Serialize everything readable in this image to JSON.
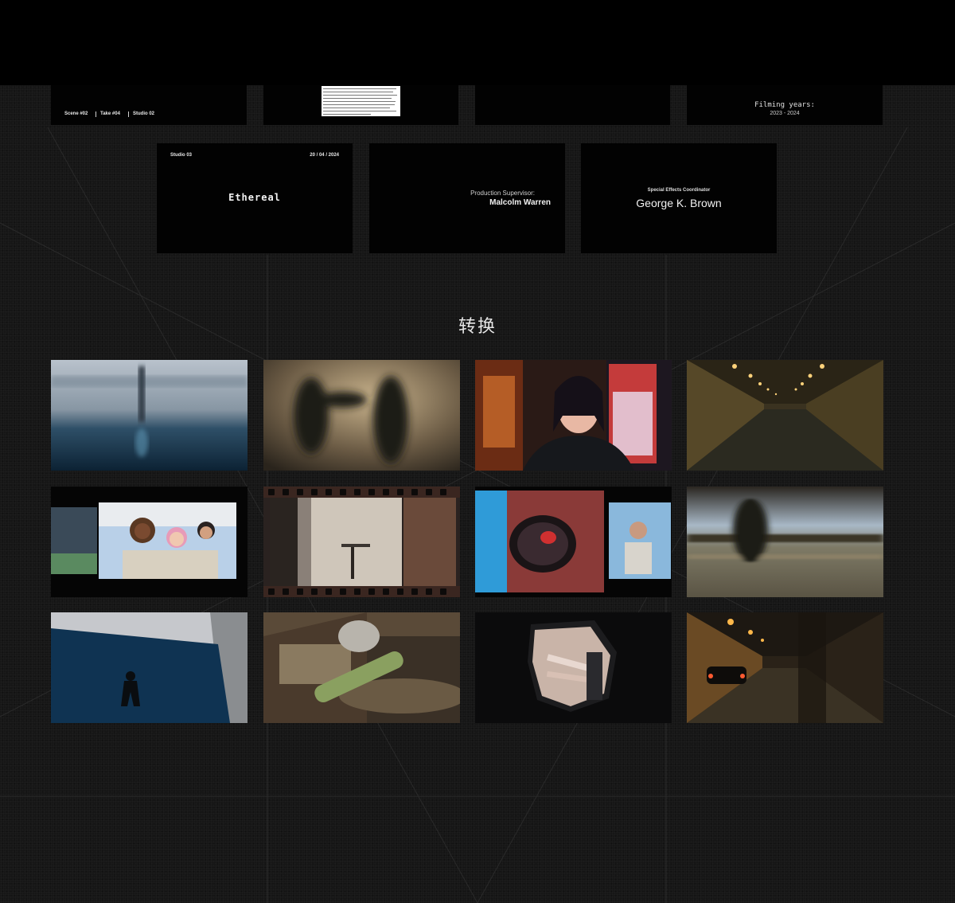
{
  "top_row": {
    "card1": {
      "scene": "Scene #02",
      "take": "Take #04",
      "studio": "Studio 02"
    },
    "card4": {
      "label": "Filming years:",
      "years": "2023 - 2024"
    }
  },
  "second_row": {
    "card1": {
      "studio": "Studio 03",
      "date": "20 / 04 / 2024",
      "title": "Ethereal"
    },
    "card2": {
      "role": "Production Supervisor:",
      "name": "Malcolm Warren"
    },
    "card3": {
      "role": "Special Effects Coordinator",
      "name": "George K. Brown"
    }
  },
  "section": {
    "title": "转换"
  },
  "thumbnails": [
    {
      "subject": "diver-silhouette-blur"
    },
    {
      "subject": "fight-motion-blur"
    },
    {
      "subject": "girl-neon-street"
    },
    {
      "subject": "tunnel-empty"
    },
    {
      "subject": "friends-selfie-slide"
    },
    {
      "subject": "film-strip-studio"
    },
    {
      "subject": "glasses-split-screen"
    },
    {
      "subject": "motion-blur-field"
    },
    {
      "subject": "underwater-diver"
    },
    {
      "subject": "skateboard-workshop"
    },
    {
      "subject": "piano-hands-iris"
    },
    {
      "subject": "tunnel-car"
    }
  ]
}
